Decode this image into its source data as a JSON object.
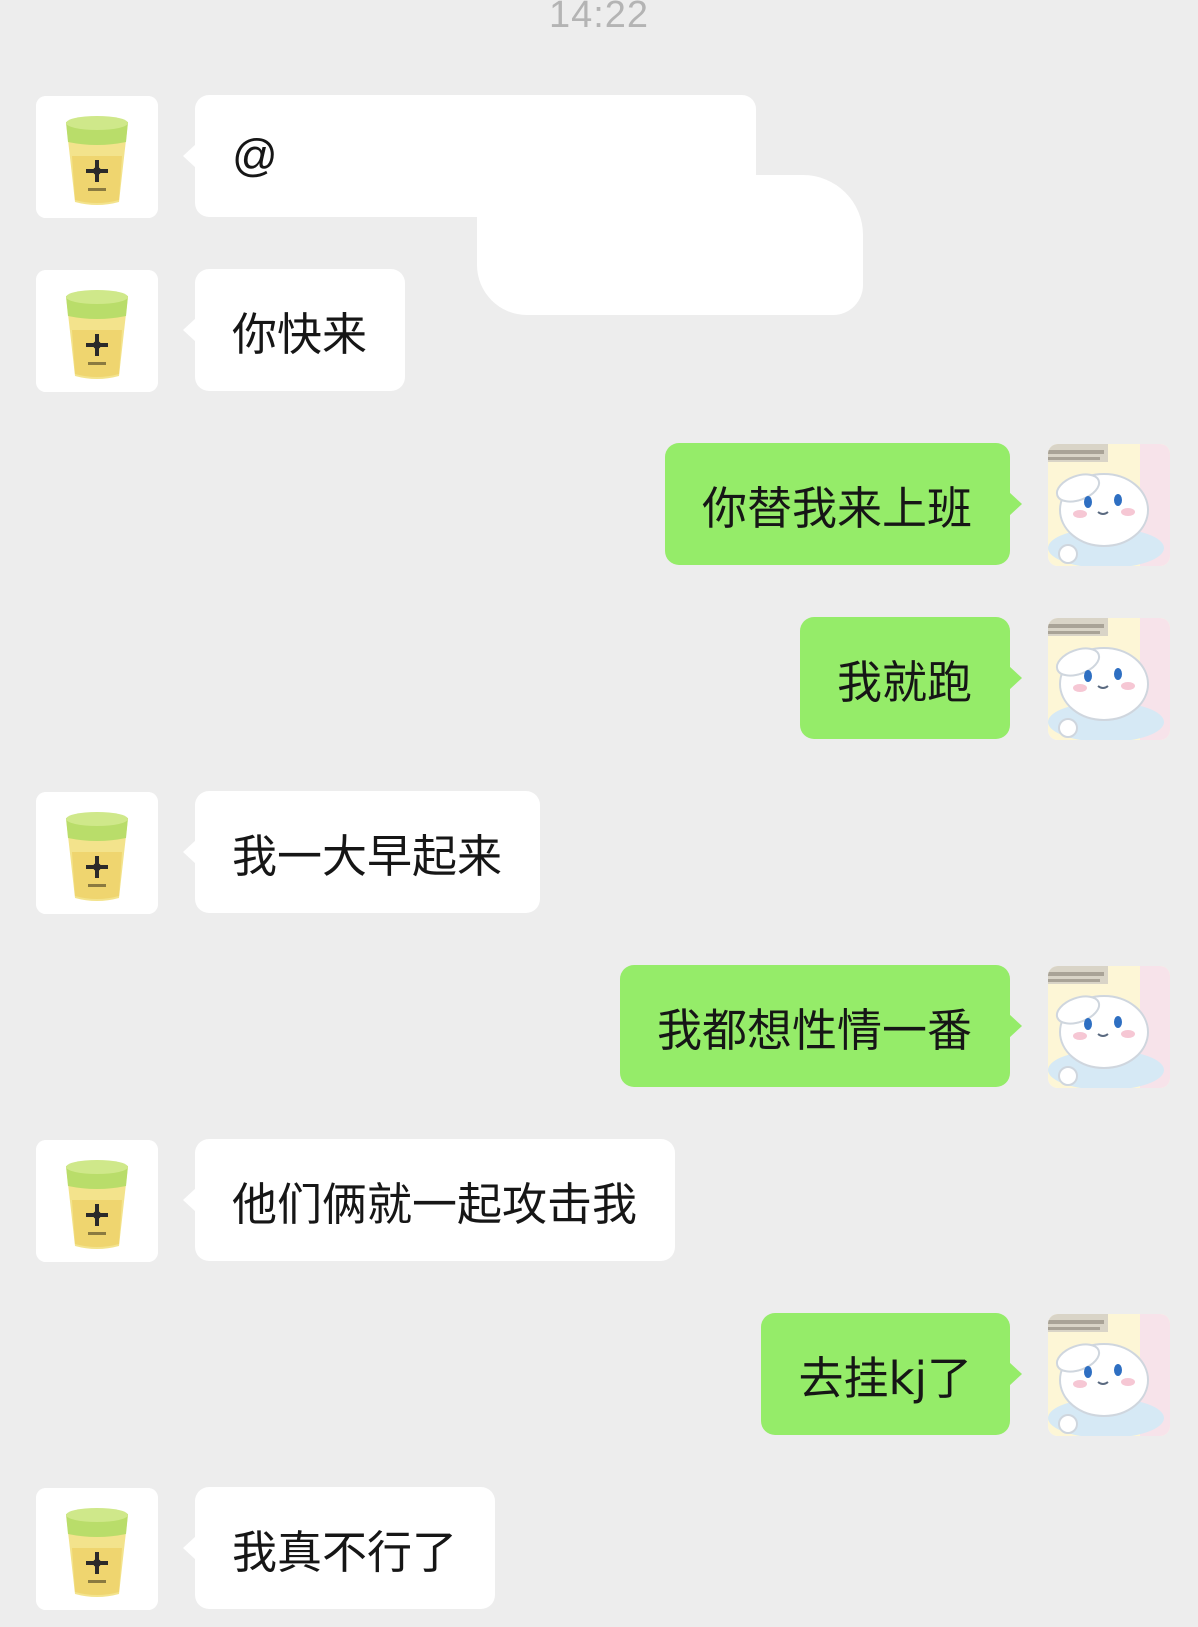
{
  "chat": {
    "timestamp": "14:22",
    "messages": [
      {
        "side": "in",
        "text": "@"
      },
      {
        "side": "in",
        "text": "你快来"
      },
      {
        "side": "out",
        "text": "你替我来上班"
      },
      {
        "side": "out",
        "text": "我就跑"
      },
      {
        "side": "in",
        "text": "我一大早起来"
      },
      {
        "side": "out",
        "text": "我都想性情一番"
      },
      {
        "side": "in",
        "text": "他们俩就一起攻击我"
      },
      {
        "side": "out",
        "text": "去挂kj了"
      },
      {
        "side": "in",
        "text": "我真不行了"
      }
    ]
  },
  "avatars": {
    "contact_icon": "milk-tea-cup-icon",
    "self_icon": "cinnamoroll-bunny-icon"
  },
  "colors": {
    "background": "#ededed",
    "incoming_bubble": "#ffffff",
    "outgoing_bubble": "#95ec69",
    "timestamp": "#b4b4b4"
  }
}
